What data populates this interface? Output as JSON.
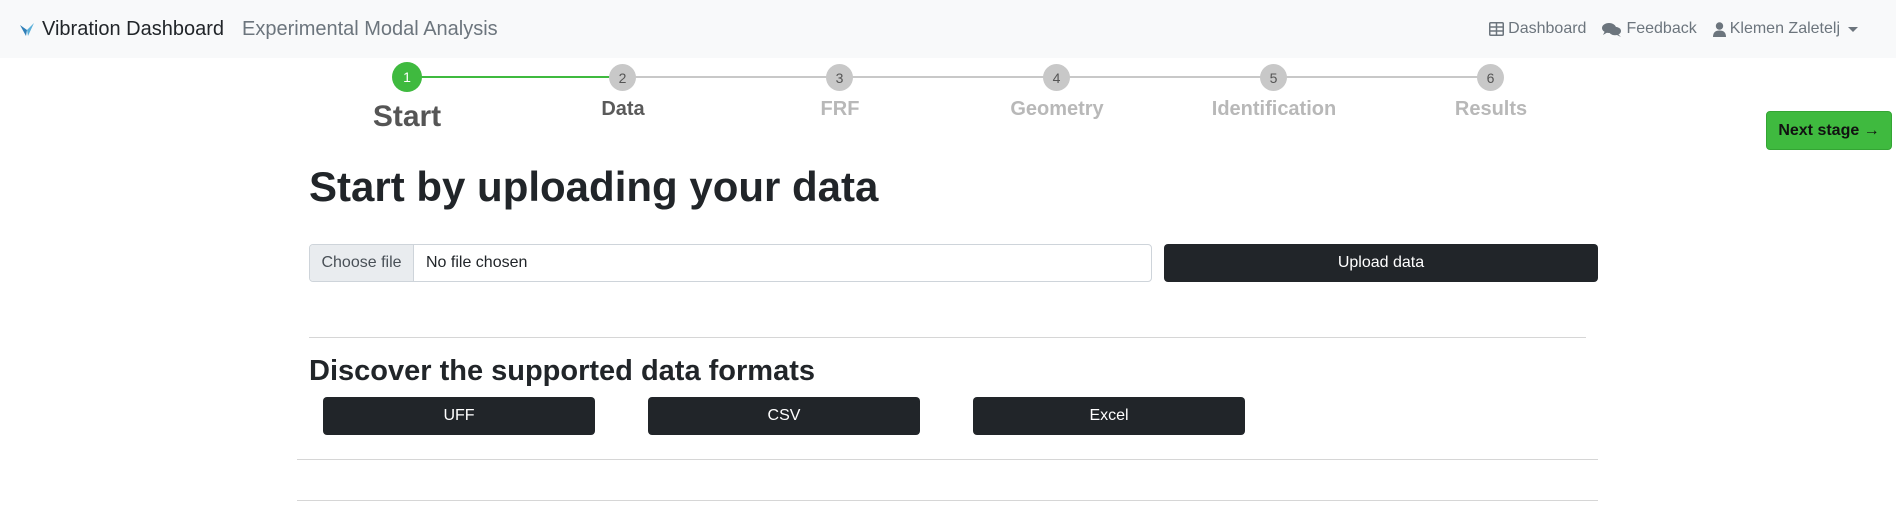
{
  "navbar": {
    "brand": "Vibration Dashboard",
    "subtitle": "Experimental Modal Analysis",
    "dashboard_link": "Dashboard",
    "feedback_link": "Feedback",
    "user_name": "Klemen Zaletelj"
  },
  "stepper": {
    "steps": [
      {
        "number": "1",
        "label": "Start",
        "state": "current"
      },
      {
        "number": "2",
        "label": "Data",
        "state": "next"
      },
      {
        "number": "3",
        "label": "FRF",
        "state": "pending"
      },
      {
        "number": "4",
        "label": "Geometry",
        "state": "pending"
      },
      {
        "number": "5",
        "label": "Identification",
        "state": "pending"
      },
      {
        "number": "6",
        "label": "Results",
        "state": "pending"
      }
    ]
  },
  "next_stage_label": "Next stage →",
  "main": {
    "heading": "Start by uploading your data",
    "file_input": {
      "button_label": "Choose file",
      "status": "No file chosen"
    },
    "upload_button": "Upload data",
    "formats_heading": "Discover the supported data formats",
    "formats": [
      "UFF",
      "CSV",
      "Excel"
    ]
  },
  "colors": {
    "accent_green": "#3fba3f",
    "dark_button": "#212529",
    "navbar_bg": "#f8f9fa",
    "step_inactive": "#c8c8c8"
  }
}
